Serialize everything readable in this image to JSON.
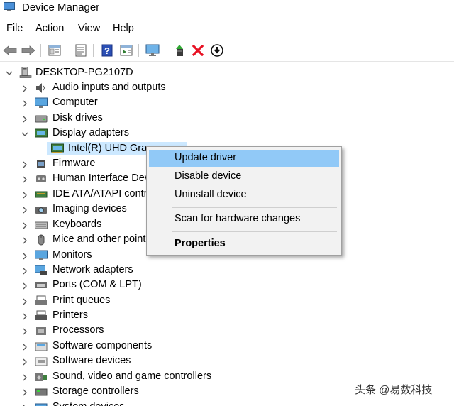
{
  "window": {
    "title": "Device Manager"
  },
  "menu": [
    "File",
    "Action",
    "View",
    "Help"
  ],
  "toolbar": {
    "buttons": [
      "back-arrow-icon",
      "forward-arrow-icon",
      "properties-sheet-icon",
      "details-list-icon",
      "help-icon",
      "action-pane-icon",
      "monitor-icon",
      "add-driver-icon",
      "uninstall-x-icon",
      "download-icon"
    ]
  },
  "tree": {
    "root": "DESKTOP-PG2107D",
    "categories": [
      "Audio inputs and outputs",
      "Computer",
      "Disk drives",
      "Display adapters",
      "Firmware",
      "Human Interface Dev",
      "IDE ATA/ATAPI contro",
      "Imaging devices",
      "Keyboards",
      "Mice and other point",
      "Monitors",
      "Network adapters",
      "Ports (COM & LPT)",
      "Print queues",
      "Printers",
      "Processors",
      "Software components",
      "Software devices",
      "Sound, video and game controllers",
      "Storage controllers",
      "System devices"
    ],
    "display_child": "Intel(R) UHD Grap"
  },
  "context_menu": {
    "items": [
      "Update driver",
      "Disable device",
      "Uninstall device",
      "Scan for hardware changes",
      "Properties"
    ]
  },
  "watermark": "头条 @易数科技",
  "colors": {
    "selection": "#cce8ff",
    "menu_highlight": "#91c9f7",
    "close_red": "#e81123"
  }
}
